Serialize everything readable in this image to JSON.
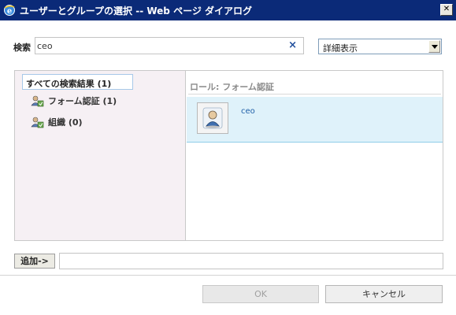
{
  "window": {
    "title": "ユーザーとグループの選択 -- Web ページ ダイアログ",
    "close_label": "✕"
  },
  "search": {
    "label": "検索",
    "value": "ceo",
    "clear_label": "×"
  },
  "view_select": {
    "selected": "詳細表示"
  },
  "results": {
    "all_label": "すべての検索結果 (1)",
    "categories": [
      {
        "label": "フォーム認証 (1)"
      },
      {
        "label": "組織 (0)"
      }
    ],
    "group_header": "ロール: フォーム認証",
    "items": [
      {
        "name": "ceo"
      }
    ]
  },
  "add": {
    "button_label": "追加->",
    "value": ""
  },
  "footer": {
    "ok_label": "OK",
    "cancel_label": "キャンセル"
  },
  "colors": {
    "titlebar": "#0b2a78",
    "left_pane": "#f6f0f4",
    "selected_row": "#dff2fa",
    "link_blue": "#2060a8"
  }
}
